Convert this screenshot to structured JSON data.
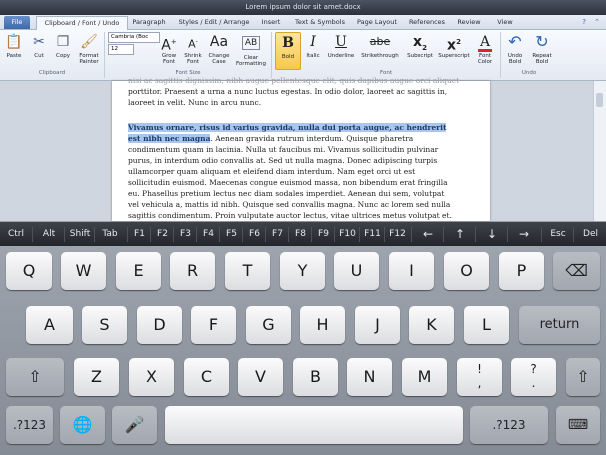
{
  "window": {
    "title": "Lorem ipsum dolor sit amet.docx"
  },
  "ribbon_tabs": [
    "File",
    "Clipboard / Font / Undo",
    "Paragraph",
    "Styles / Edit / Arrange",
    "Insert",
    "Text & Symbols",
    "Page Layout",
    "References",
    "Review",
    "View"
  ],
  "clipboard": {
    "paste": "Paste",
    "cut": "Cut",
    "copy": "Copy",
    "format_painter": "Format Painter",
    "group": "Clipboard"
  },
  "font": {
    "name": "Cambria (Boc",
    "size": "12",
    "grow": "Grow Font",
    "shrink": "Shrink Font",
    "change_case": "Change Case",
    "clear": "Clear Formatting",
    "size_group": "Font Size",
    "bold": "Bold",
    "italic": "Italic",
    "underline": "Underline",
    "strikethrough": "Strikethrough",
    "subscript": "Subscript",
    "superscript": "Superscript",
    "font_color": "Font Color",
    "group": "Font"
  },
  "undo": {
    "undo": "Undo Bold",
    "repeat": "Repeat Bold",
    "group": "Undo"
  },
  "document": {
    "para1_cut": "nisi ac sagittis dignissim, nibh augue pellentesque elit, quis dapibus augue orci aliquet",
    "para1_l1": "porttitor. Praesent a urna a nunc luctus egestas. In odio dolor, laoreet ac sagittis in,",
    "para1_l2": "laoreet in velit. Nunc in arcu nunc.",
    "sel1": "Vivamus ornare, risus id varius gravida, nulla dui porta augue, ac hendrerit",
    "sel2": "est nibh nec magna",
    "p2_l2_rest": ". Aenean gravida rutrum interdum. Quisque pharetra",
    "p2_l3": "condimentum quam in lacinia. Nulla ut faucibus mi. Vivamus sollicitudin pulvinar",
    "p2_l4": "purus, in interdum odio convallis at. Sed ut nulla magna. Donec adipiscing turpis",
    "p2_l5": "ullamcorper quam aliquam et eleifend diam interdum. Nam eget orci ut est",
    "p2_l6": "sollicitudin euismod. Maecenas congue euismod massa, non bibendum erat fringilla",
    "p2_l7": "eu. Phasellus pretium lectus nec diam sodales imperdiet. Aenean dui sem, volutpat",
    "p2_l8": "vel vehicula a, mattis id nibh. Quisque sed convallis magna. Nunc ac lorem sed nulla",
    "p2_l9": "sagittis condimentum. Proin vulputate auctor lectus, vitae ultrices metus volutpat et."
  },
  "fn_keys": [
    "Ctrl",
    "Alt",
    "Shift",
    "Tab",
    "F1",
    "F2",
    "F3",
    "F4",
    "F5",
    "F6",
    "F7",
    "F8",
    "F9",
    "F10",
    "F11",
    "F12",
    "←",
    "↑",
    "↓",
    "→",
    "Esc",
    "Del"
  ],
  "keyboard": {
    "row1": [
      "Q",
      "W",
      "E",
      "R",
      "T",
      "Y",
      "U",
      "I",
      "O",
      "P"
    ],
    "row2": [
      "A",
      "S",
      "D",
      "F",
      "G",
      "H",
      "J",
      "K",
      "L"
    ],
    "row3": [
      "Z",
      "X",
      "C",
      "V",
      "B",
      "N",
      "M"
    ],
    "return": "return",
    "num": ".?123",
    "excl": "!\n,",
    "ques": "?\n."
  },
  "colors": {
    "accent": "#3e6aa9",
    "selection": "#a9c6ec",
    "bold_active": "#f8c84a"
  }
}
